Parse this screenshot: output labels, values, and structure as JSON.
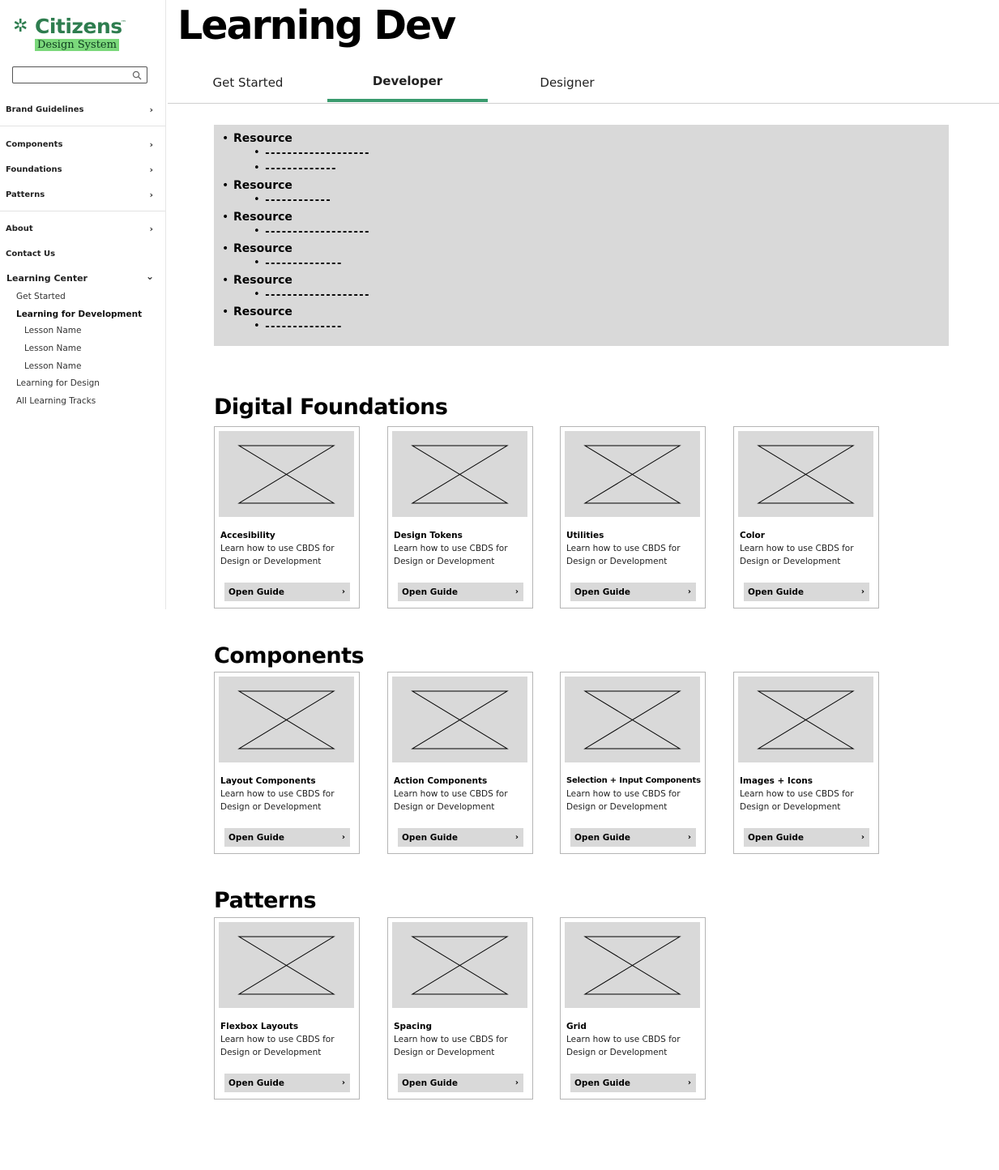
{
  "brand": {
    "name": "Citizens",
    "trademark": "™",
    "subtitle": "Design System",
    "primary_color": "#2e7d4f",
    "highlight_color": "#7bd87b",
    "accent_color": "#3a9b6e"
  },
  "search": {
    "value": "",
    "placeholder": "",
    "icon": "search-icon"
  },
  "sidebar": {
    "items": [
      {
        "label": "Brand Guidelines",
        "chevron": "›"
      },
      {
        "label": "Components",
        "chevron": "›"
      },
      {
        "label": "Foundations",
        "chevron": "›"
      },
      {
        "label": "Patterns",
        "chevron": "›"
      },
      {
        "label": "About",
        "chevron": "›"
      },
      {
        "label": "Contact Us"
      },
      {
        "label": "Learning Center",
        "chevron": "⌄"
      }
    ],
    "learning_center": {
      "children": [
        {
          "label": "Get Started"
        },
        {
          "label": "Learning for Development"
        },
        {
          "label": "Lesson Name"
        },
        {
          "label": "Lesson Name"
        },
        {
          "label": "Lesson Name"
        },
        {
          "label": "Learning for Design"
        },
        {
          "label": "All Learning Tracks"
        }
      ]
    }
  },
  "page": {
    "title": "Learning Dev"
  },
  "tabs": [
    {
      "label": "Get Started",
      "active": false
    },
    {
      "label": "Developer",
      "active": true
    },
    {
      "label": "Designer",
      "active": false
    }
  ],
  "resources": [
    {
      "label": "Resource",
      "subs": [
        "-------------------",
        "-------------"
      ]
    },
    {
      "label": "Resource",
      "subs": [
        "------------"
      ]
    },
    {
      "label": "Resource",
      "subs": [
        "-------------------"
      ]
    },
    {
      "label": "Resource",
      "subs": [
        "--------------"
      ]
    },
    {
      "label": "Resource",
      "subs": [
        "-------------------"
      ]
    },
    {
      "label": "Resource",
      "subs": [
        "--------------"
      ]
    }
  ],
  "sections": [
    {
      "title": "Digital Foundations",
      "cards": [
        {
          "title": "Accesibility",
          "desc": "Learn how to use CBDS for Design or Development",
          "button": "Open Guide"
        },
        {
          "title": "Design Tokens",
          "desc": "Learn how to use CBDS for Design or Development",
          "button": "Open Guide"
        },
        {
          "title": "Utilities",
          "desc": "Learn how to use CBDS for Design or Development",
          "button": "Open Guide"
        },
        {
          "title": "Color",
          "desc": "Learn how to use CBDS for Design or Development",
          "button": "Open Guide"
        }
      ]
    },
    {
      "title": "Components",
      "cards": [
        {
          "title": "Layout Components",
          "desc": "Learn how to use CBDS for Design or Development",
          "button": "Open Guide"
        },
        {
          "title": "Action Components",
          "desc": "Learn how to use CBDS for Design or Development",
          "button": "Open Guide"
        },
        {
          "title": "Selection + Input Components",
          "desc": "Learn how to use CBDS for Design or Development",
          "button": "Open Guide"
        },
        {
          "title": "Images + Icons",
          "desc": "Learn how to use CBDS for Design or Development",
          "button": "Open Guide"
        }
      ]
    },
    {
      "title": "Patterns",
      "cards": [
        {
          "title": "Flexbox Layouts",
          "desc": "Learn how to use CBDS for Design or Development",
          "button": "Open Guide"
        },
        {
          "title": "Spacing",
          "desc": "Learn how to use CBDS for Design or Development",
          "button": "Open Guide"
        },
        {
          "title": "Grid",
          "desc": "Learn how to use CBDS for Design or Development",
          "button": "Open Guide"
        }
      ]
    }
  ],
  "card_button_chevron": "›"
}
